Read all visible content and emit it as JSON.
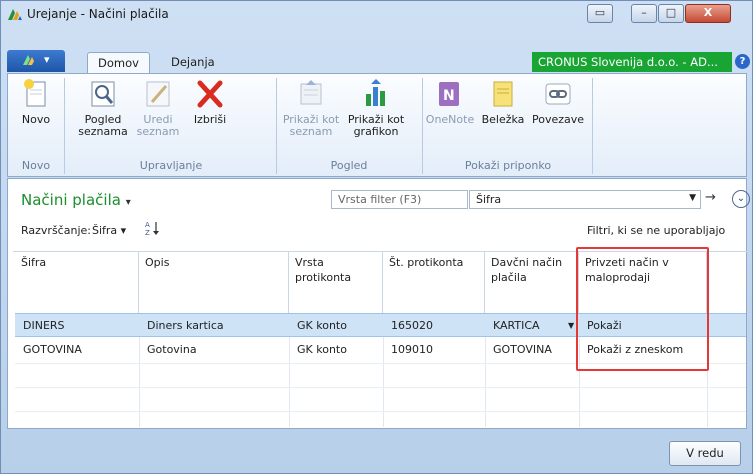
{
  "window": {
    "title": "Urejanje - Načini plačila",
    "controls": {
      "restore": "▭",
      "minimize": "–",
      "maximize": "□",
      "close": "X"
    }
  },
  "tabs": {
    "app_menu": "▾",
    "home": "Domov",
    "actions": "Dejanja"
  },
  "company": "CRONUS Slovenija d.o.o. - AD...",
  "help": "?",
  "ribbon": {
    "new_label": "Novo",
    "view_list_label_1": "Pogled",
    "view_list_label_2": "seznama",
    "edit_list_label_1": "Uredi",
    "edit_list_label_2": "seznam",
    "delete_label": "Izbriši",
    "show_list_label_1": "Prikaži kot",
    "show_list_label_2": "seznam",
    "show_chart_label_1": "Prikaži kot",
    "show_chart_label_2": "grafikon",
    "onenote_label": "OneNote",
    "note_label": "Beležka",
    "links_label": "Povezave",
    "group_new": "Novo",
    "group_manage": "Upravljanje",
    "group_view": "Pogled",
    "group_attachments": "Pokaži priponko"
  },
  "page": {
    "title": "Načini plačila",
    "title_caret": "▾",
    "filter_placeholder": "Vrsta filter (F3)",
    "filter_field": "Šifra",
    "sort_label": "Razvrščanje:",
    "sort_value": "Šifra ▾",
    "filters_note": "Filtri, ki se ne uporabljajo"
  },
  "table": {
    "headers": [
      "Šifra",
      "Opis",
      "Vrsta protikonta",
      "Št. protikonta",
      "Davčni način plačila",
      "Privzeti način v maloprodaji"
    ],
    "rows": [
      [
        "DINERS",
        "Diners kartica",
        "GK konto",
        "165020",
        "KARTICA",
        "Pokaži"
      ],
      [
        "GOTOVINA",
        "Gotovina",
        "GK konto",
        "109010",
        "GOTOVINA",
        "Pokaži z zneskom"
      ]
    ]
  },
  "footer": {
    "ok": "V redu"
  }
}
